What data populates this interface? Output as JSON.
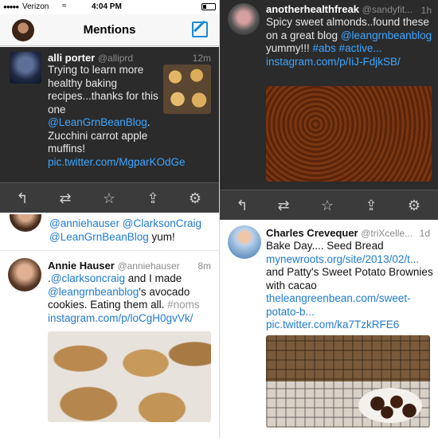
{
  "status_bar": {
    "carrier": "Verizon",
    "time": "4:04 PM"
  },
  "nav": {
    "title": "Mentions",
    "compose_icon": "compose-icon"
  },
  "tweets": {
    "alli": {
      "name": "alli porter",
      "handle": "@alliprd",
      "time": "12m",
      "text1": "Trying to learn more healthy baking recipes...thanks for this one",
      "link1": "@LeanGrnBeanBlog",
      "text2": ". Zucchini carrot apple muffins!",
      "link2": "pic.twitter.com/MgparKOdGe"
    },
    "another": {
      "name": "anotherhealthfreak",
      "handle": "@sandyfit...",
      "time": "1h",
      "text1": "Spicy sweet almonds..found these on a great blog",
      "link1": "@leangrnbeanblog",
      "text2": " yummy!!!",
      "link2": "#abs #active...",
      "link3": "instagram.com/p/IiJ-FdjkSB/"
    },
    "partial": {
      "link1": "@anniehauser",
      "link2": "@ClarksonCraig",
      "link3": "@LeanGrnBeanBlog",
      "text1": " yum!"
    },
    "annie": {
      "name": "Annie Hauser",
      "handle": "@anniehauser",
      "time": "8m",
      "text0": ".",
      "link1": "@clarksoncraig",
      "text1": " and I made",
      "link2": "@leangrnbeanblog",
      "text2": "'s avocado cookies. Eating them all.",
      "hashtag": "#noms",
      "link3": "instagram.com/p/loCgH0gvVk/"
    },
    "charles": {
      "name": "Charles Crevequer",
      "handle": "@triXcelle...",
      "time": "1d",
      "text1": "Bake Day.... Seed Bread",
      "link1": "mynewroots.org/site/2013/02/t...",
      "text2": "and Patty's Sweet Potato Brownies with cacao",
      "link2": "theleangreenbean.com/sweet-potato-b...",
      "link3": "pic.twitter.com/ka7TzkRFE6"
    }
  },
  "actions": [
    "reply-icon",
    "retweet-icon",
    "favorite-icon",
    "share-icon",
    "settings-icon"
  ],
  "colors": {
    "link_dark": "#3ea6ff",
    "link_light": "#1f7ad3",
    "dark_bg": "#2b2b2b",
    "accent": "#1a8cd8"
  }
}
